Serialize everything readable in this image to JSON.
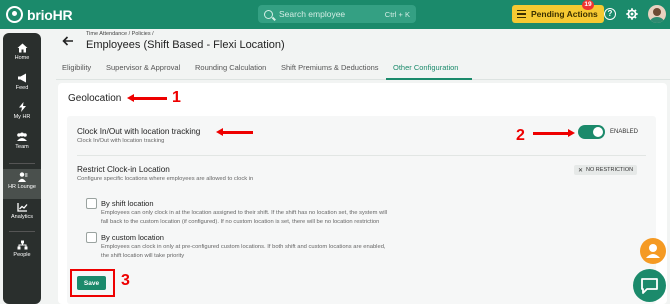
{
  "app": {
    "logo_text": "brioHR"
  },
  "search": {
    "placeholder": "Search employee",
    "shortcut": "Ctrl + K"
  },
  "header_actions": {
    "pending_label": "Pending Actions",
    "pending_count": "19"
  },
  "sidebar": {
    "items": [
      {
        "label": "Home",
        "icon": "home-icon"
      },
      {
        "label": "Feed",
        "icon": "megaphone-icon"
      },
      {
        "label": "My HR",
        "icon": "lightning-icon"
      },
      {
        "label": "Team",
        "icon": "team-icon"
      },
      {
        "label": "HR Lounge",
        "icon": "hr-lounge-icon"
      },
      {
        "label": "Analytics",
        "icon": "analytics-icon"
      },
      {
        "label": "People",
        "icon": "people-icon"
      }
    ],
    "active": "HR Lounge"
  },
  "breadcrumb": {
    "text": "Time Attendance / Policies /"
  },
  "page": {
    "title": "Employees (Shift Based - Flexi Location)"
  },
  "tabs": [
    {
      "label": "Eligibility"
    },
    {
      "label": "Supervisor & Approval"
    },
    {
      "label": "Rounding Calculation"
    },
    {
      "label": "Shift Premiums & Deductions"
    },
    {
      "label": "Other Configuration"
    }
  ],
  "active_tab": "Other Configuration",
  "section": {
    "title": "Geolocation"
  },
  "tracking": {
    "title": "Clock In/Out with location tracking",
    "subtitle": "Clock In/Out with location tracking",
    "toggle_state": "ENABLED",
    "enabled": true
  },
  "restrict": {
    "title": "Restrict Clock-in Location",
    "subtitle": "Configure specific locations where employees are allowed to clock in",
    "chip_label": "NO RESTRICTION",
    "options": [
      {
        "title": "By shift location",
        "desc_line1": "Employees can only clock in at the location assigned to their shift. If the shift has no location set, the system will",
        "desc_line2": "fall back to the custom location (if configured). If no custom location is set, there will be no location restriction",
        "checked": false
      },
      {
        "title": "By custom location",
        "desc_line1": "Employees can clock in only at pre-configured custom locations. If both shift and custom locations are enabled,",
        "desc_line2": "the shift location will take priority",
        "checked": false
      }
    ]
  },
  "save": {
    "label": "Save"
  },
  "annotations": {
    "one": "1",
    "two": "2",
    "three": "3",
    "color": "#e00000"
  },
  "colors": {
    "brand": "#1b8a6b",
    "pending": "#f5c932",
    "fab_user": "#f59a23"
  }
}
